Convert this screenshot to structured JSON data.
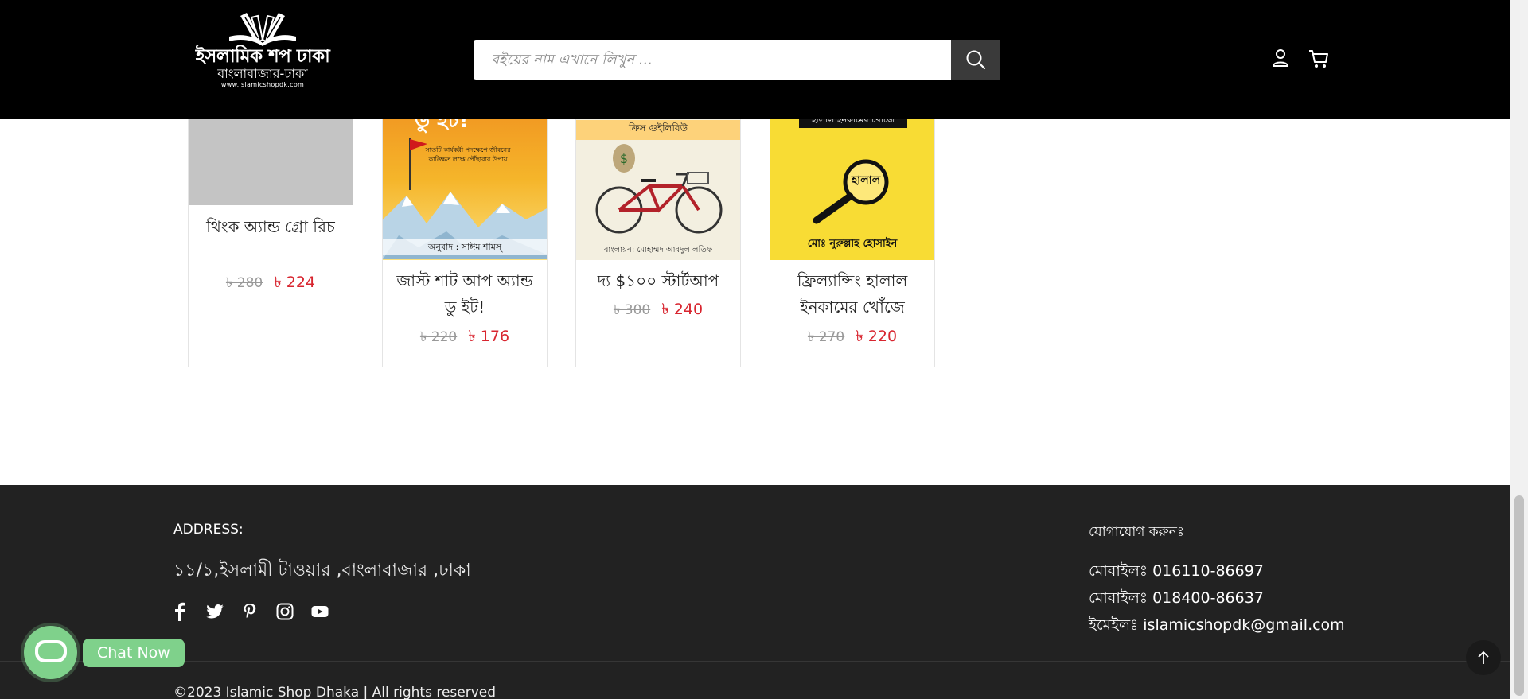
{
  "header": {
    "logo": {
      "line1": "ইসলামিক শপ ঢাকা",
      "line2": "বাংলাবাজার-ঢাকা",
      "line3": "www.islamicshopdk.com"
    },
    "search": {
      "placeholder": "বইয়ের নাম এখানে লিখুন ..."
    },
    "icons": {
      "search": "search-icon",
      "account": "user-icon",
      "cart": "cart-icon"
    }
  },
  "products": [
    {
      "title": "থিংক অ্যান্ড গ্রো রিচ",
      "old_price": "৳ 280",
      "new_price": "৳ 224"
    },
    {
      "title": "জাস্ট শাট আপ অ্যান্ড ডু ইট!",
      "old_price": "৳ 220",
      "new_price": "৳ 176",
      "cover_text": {
        "top": "ডু ইট!",
        "middle": "সাতটি কার্যকরী পদক্ষেপে জীবনের কাঙ্ক্ষিত লক্ষে পৌঁছাবার উপায়",
        "bottom": "অনুবাদ : সাঈম শামস্"
      }
    },
    {
      "title": "দ্য $১০০ স্টার্টআপ",
      "old_price": "৳ 300",
      "new_price": "৳ 240",
      "cover_text": {
        "top": "ক্রিস গুইলিবিউ",
        "bottom": "বাংলায়ন: মোহাম্মদ আবদুল লতিফ"
      }
    },
    {
      "title": "ফ্রিল্যান্সিং হালাল ইনকামের খোঁজে",
      "old_price": "৳ 270",
      "new_price": "৳ 220",
      "cover_text": {
        "top": "হালাল ইনকামের খোঁজে",
        "center": "হালাল",
        "bottom": "মোঃ নুরুল্লাহ হোসাইন"
      }
    }
  ],
  "footer": {
    "address_heading": "ADDRESS:",
    "address": "১১/১,ইসলামী টাওয়ার ,বাংলাবাজার ,ঢাকা",
    "contact_heading": "যোগাযোগ করুনঃ",
    "mobile1": "মোবাইলঃ 016110-86697",
    "mobile2": "মোবাইলঃ 018400-86637",
    "email": "ইমেইলঃ islamicshopdk@gmail.com",
    "social_icons": [
      "facebook-icon",
      "twitter-icon",
      "pinterest-icon",
      "instagram-icon",
      "youtube-icon"
    ],
    "copyright": "©2023 Islamic Shop Dhaka | All rights reserved"
  },
  "chat": {
    "label": "Chat Now"
  },
  "colors": {
    "header_bg": "#000000",
    "footer_bg": "#222222",
    "price_red": "#d8252f",
    "chat_green": "#7fd18b"
  }
}
